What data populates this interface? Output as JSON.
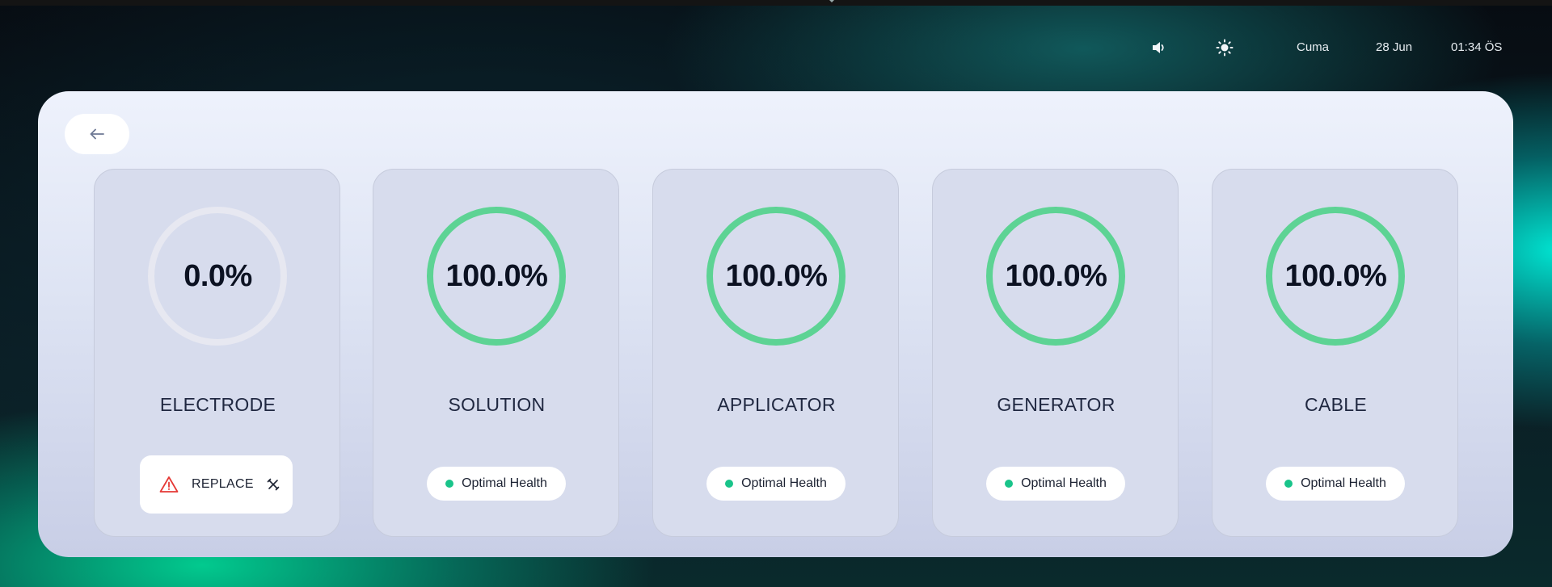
{
  "statusbar": {
    "volume_icon": "volume-icon",
    "brightness_icon": "brightness-icon",
    "day": "Cuma",
    "date": "28 Jun",
    "time": "01:34 ÖS"
  },
  "navigation": {
    "back_icon": "arrow-left-icon"
  },
  "colors": {
    "healthy_ring": "#5dd394",
    "empty_ring": "#e7e8f1",
    "status_dot": "#19c48a",
    "warning": "#e53935"
  },
  "components": [
    {
      "name": "ELECTRODE",
      "percent_label": "0.0%",
      "health_fraction": 0.0,
      "status": "replace",
      "action_label": "REPLACE",
      "warning_icon": "warning-triangle-icon",
      "action_icon": "tools-icon"
    },
    {
      "name": "SOLUTION",
      "percent_label": "100.0%",
      "health_fraction": 1.0,
      "status": "optimal",
      "status_label": "Optimal Health"
    },
    {
      "name": "APPLICATOR",
      "percent_label": "100.0%",
      "health_fraction": 1.0,
      "status": "optimal",
      "status_label": "Optimal Health"
    },
    {
      "name": "GENERATOR",
      "percent_label": "100.0%",
      "health_fraction": 1.0,
      "status": "optimal",
      "status_label": "Optimal Health"
    },
    {
      "name": "CABLE",
      "percent_label": "100.0%",
      "health_fraction": 1.0,
      "status": "optimal",
      "status_label": "Optimal Health"
    }
  ]
}
